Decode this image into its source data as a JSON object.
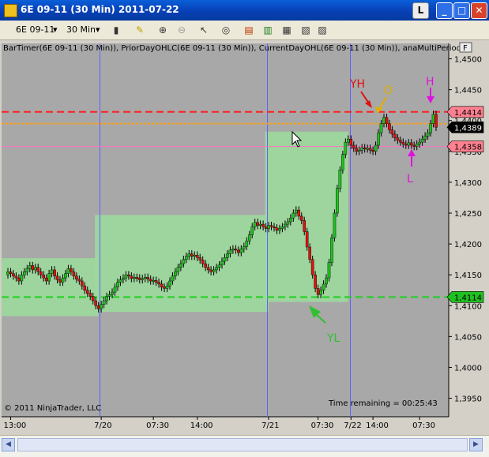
{
  "window": {
    "title": "6E 09-11 (30 Min)  2011-07-22",
    "l_button": "L",
    "min_glyph": "_",
    "max_glyph": "□",
    "close_glyph": "✕"
  },
  "toolbar": {
    "instrument": "6E 09-11",
    "interval": "30 Min",
    "dropdown_glyph": "▾"
  },
  "chart": {
    "indicator_label": "BarTimer(6E 09-11 (30 Min)), PriorDayOHLC(6E 09-11 (30 Min)), CurrentDayOHL(6E 09-11 (30 Min)), anaMultiPeriod",
    "f_box": "F",
    "copyright": "© 2011 NinjaTrader, LLC",
    "time_remaining": "Time remaining = 00:25:43",
    "annotations": [
      {
        "text": "YH",
        "color": "#e01010"
      },
      {
        "text": "O",
        "color": "#e0b000"
      },
      {
        "text": "H",
        "color": "#e010e0"
      },
      {
        "text": "L",
        "color": "#e010e0"
      },
      {
        "text": "YL",
        "color": "#30c030"
      }
    ],
    "price_tags": [
      {
        "text": "1,4414",
        "bg": "#ff8090",
        "fg": "#000000"
      },
      {
        "text": "1,4389",
        "bg": "#000000",
        "fg": "#ffffff"
      },
      {
        "text": "1,4358",
        "bg": "#ff8090",
        "fg": "#000000"
      },
      {
        "text": "1,4114",
        "bg": "#20c020",
        "fg": "#000000"
      }
    ],
    "colors": {
      "bg": "#a8a8a8",
      "up": "#20c020",
      "down": "#e01010",
      "zone": "#9cd89c",
      "yh": "#ff2020",
      "yl": "#20d020",
      "open": "#ffa010",
      "low_line": "#ff70c0",
      "sep": "#6060ff"
    }
  },
  "chart_data": {
    "type": "candlestick",
    "ylim": [
      1.392,
      1.4525
    ],
    "y_ticks": [
      "1,4500",
      "1,4450",
      "1,4400",
      "1,4350",
      "1,4300",
      "1,4250",
      "1,4200",
      "1,4150",
      "1,4100",
      "1,4050",
      "1,4000",
      "1,3950"
    ],
    "y_tick_values": [
      1.45,
      1.445,
      1.44,
      1.435,
      1.43,
      1.425,
      1.42,
      1.415,
      1.41,
      1.405,
      1.4,
      1.395
    ],
    "x_ticks": [
      "13:00",
      "7/20",
      "07:30",
      "14:00",
      "7/21",
      "07:30",
      "14:00",
      "7/22",
      "07:30"
    ],
    "levels": {
      "yh": 1.4414,
      "yl": 1.4114,
      "open": 1.4395,
      "current": 1.4389,
      "low": 1.4358,
      "high": 1.4414
    },
    "closes": [
      1.4155,
      1.4152,
      1.4148,
      1.4145,
      1.414,
      1.415,
      1.4155,
      1.416,
      1.4165,
      1.4158,
      1.4162,
      1.4155,
      1.415,
      1.4145,
      1.414,
      1.4152,
      1.4158,
      1.4148,
      1.4142,
      1.4138,
      1.4145,
      1.4152,
      1.416,
      1.4155,
      1.4148,
      1.4143,
      1.414,
      1.4132,
      1.4125,
      1.412,
      1.4115,
      1.4108,
      1.41,
      1.4095,
      1.4102,
      1.4108,
      1.4115,
      1.4118,
      1.4122,
      1.413,
      1.4138,
      1.4142,
      1.4145,
      1.415,
      1.4148,
      1.4144,
      1.4146,
      1.4145,
      1.4142,
      1.4144,
      1.4146,
      1.4143,
      1.414,
      1.4141,
      1.4138,
      1.4135,
      1.413,
      1.4128,
      1.4132,
      1.414,
      1.4148,
      1.4155,
      1.4162,
      1.4168,
      1.4175,
      1.418,
      1.4184,
      1.418,
      1.4182,
      1.4178,
      1.4174,
      1.4168,
      1.4162,
      1.4158,
      1.4155,
      1.4158,
      1.4162,
      1.4166,
      1.4172,
      1.4178,
      1.4184,
      1.419,
      1.4192,
      1.419,
      1.4186,
      1.4192,
      1.4196,
      1.4205,
      1.4215,
      1.4228,
      1.4235,
      1.423,
      1.4232,
      1.4228,
      1.4225,
      1.423,
      1.4228,
      1.4226,
      1.4222,
      1.4225,
      1.4228,
      1.4232,
      1.4236,
      1.4242,
      1.425,
      1.4255,
      1.4245,
      1.4238,
      1.422,
      1.4195,
      1.4175,
      1.415,
      1.4128,
      1.4118,
      1.4125,
      1.4135,
      1.4145,
      1.417,
      1.421,
      1.425,
      1.429,
      1.432,
      1.4345,
      1.4365,
      1.437,
      1.436,
      1.4355,
      1.435,
      1.4352,
      1.4356,
      1.4354,
      1.4355,
      1.4352,
      1.435,
      1.436,
      1.438,
      1.4395,
      1.4405,
      1.4395,
      1.4385,
      1.4378,
      1.4372,
      1.4368,
      1.4365,
      1.4362,
      1.436,
      1.4364,
      1.436,
      1.4358,
      1.4362,
      1.4365,
      1.437,
      1.4375,
      1.438,
      1.4395,
      1.441,
      1.4389
    ]
  }
}
